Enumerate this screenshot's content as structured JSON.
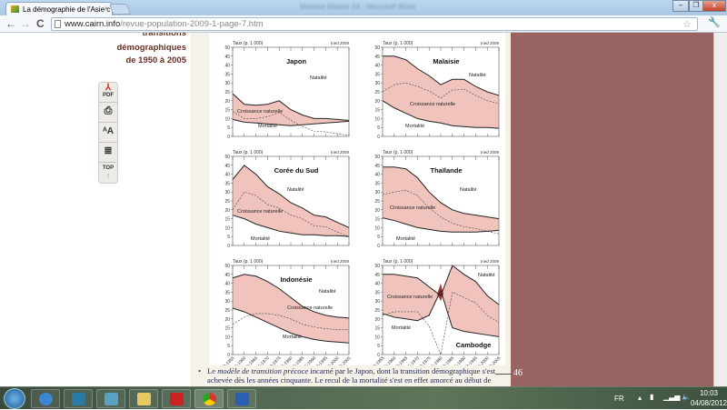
{
  "browser": {
    "tab_title": "La démographie de l'Asie c",
    "window_title": "Mélanie Master 2A - Microsoft Word",
    "url_host": "www.cairn.info",
    "url_path": "/revue-population-2009-1-page-7.htm"
  },
  "sidebar": {
    "heading_lines": [
      "transitions",
      "démographiques",
      "de 1950 à 2005"
    ],
    "tools": [
      {
        "icon": "pdf-icon",
        "label": "PDF"
      },
      {
        "icon": "print-icon",
        "label": ""
      },
      {
        "icon": "font-size-icon",
        "label": "ᴬA"
      },
      {
        "icon": "add-list-icon",
        "label": ""
      },
      {
        "icon": "top-arrow-icon",
        "label": "TOP"
      }
    ]
  },
  "page": {
    "paragraph_line1_pre": "Le ",
    "paragraph_line1_em": "modèle de transition précoce",
    "paragraph_line1_post": " incarné par le Japon, dont la transition démographique s'est",
    "paragraph_line2": "achevée dès les années cinquante. Le recul de la mortalité s'est en effet amorcé au début de",
    "page_number": "46"
  },
  "chart_data": {
    "type": "area",
    "ylabel": "Taux (p. 1 000)",
    "source": "Ined 2009",
    "ylim": [
      0,
      50
    ],
    "yticks": [
      0,
      5,
      10,
      15,
      20,
      25,
      30,
      35,
      40,
      45,
      50
    ],
    "categories": [
      "1950-1955",
      "1955-1960",
      "1960-1965",
      "1965-1970",
      "1970-1975",
      "1975-1980",
      "1980-1985",
      "1985-1990",
      "1990-1995",
      "1995-2000",
      "2000-2005"
    ],
    "series_labels": {
      "natality": "Natalité",
      "growth": "Croissance naturelle",
      "mortality": "Mortalité"
    },
    "colors": {
      "fill": "#f0c4bd",
      "crisis": "#b03a3a",
      "line": "#222222"
    },
    "panels": [
      {
        "title": "Japon",
        "natality": [
          24,
          18,
          17.5,
          18,
          20,
          15,
          12,
          10,
          10,
          9.5,
          9
        ],
        "mortality": [
          9.5,
          8,
          7.5,
          7,
          6.5,
          6,
          6.5,
          7,
          7.5,
          8,
          8.5
        ],
        "growth": [
          14,
          10,
          10,
          11,
          13.5,
          9,
          5.5,
          3,
          2.5,
          1.5,
          0.5
        ]
      },
      {
        "title": "Malaisie",
        "natality": [
          45,
          45,
          43,
          38,
          34,
          29,
          32,
          32,
          28,
          25,
          23
        ],
        "mortality": [
          20,
          16,
          13,
          10,
          8.5,
          7.5,
          6,
          5.5,
          5,
          5,
          4.5
        ],
        "growth": [
          25,
          29,
          30,
          28,
          25.5,
          21.5,
          26,
          26.5,
          23,
          20,
          18.5
        ]
      },
      {
        "title": "Corée du Sud",
        "natality": [
          37,
          45,
          40,
          33,
          29,
          24,
          21,
          17,
          16,
          13,
          10
        ],
        "mortality": [
          17,
          15,
          12,
          10,
          8,
          7,
          6,
          6,
          5.5,
          5.5,
          5
        ],
        "growth": [
          20,
          30,
          28,
          23,
          21,
          17,
          15,
          11,
          10.5,
          7.5,
          5
        ]
      },
      {
        "title": "Thaïlande",
        "natality": [
          44,
          44,
          43,
          38,
          30,
          24,
          20,
          18,
          17,
          16,
          15
        ],
        "mortality": [
          15.5,
          14,
          12,
          10,
          9,
          8,
          7.5,
          7.5,
          7.5,
          8,
          8.5
        ],
        "growth": [
          28.5,
          30,
          31,
          28,
          21,
          16,
          12.5,
          10.5,
          9.5,
          8,
          6.5
        ]
      },
      {
        "title": "Indonésie",
        "natality": [
          43,
          45,
          44,
          41,
          37,
          32,
          27,
          24,
          22,
          21,
          20.5
        ],
        "mortality": [
          26,
          24,
          21,
          18,
          15,
          12,
          10,
          8.5,
          7.5,
          7,
          6.5
        ],
        "growth": [
          17,
          21,
          23,
          23,
          22,
          20,
          17,
          15.5,
          14.5,
          14,
          14
        ]
      },
      {
        "title": "Cambodge",
        "natality": [
          45,
          45,
          44,
          43,
          38,
          33,
          50,
          45,
          41,
          33,
          28
        ],
        "mortality": [
          23,
          21,
          20,
          19,
          22,
          36,
          15,
          13,
          12,
          11,
          10
        ],
        "growth": [
          22,
          24,
          24,
          24,
          16,
          0,
          35,
          32,
          29,
          22,
          18
        ]
      }
    ]
  },
  "taskbar": {
    "apps": [
      "internet-explorer",
      "media-player",
      "network",
      "explorer",
      "acrobat",
      "chrome",
      "word"
    ],
    "language": "FR",
    "time": "10:03",
    "date": "04/08/2012"
  }
}
